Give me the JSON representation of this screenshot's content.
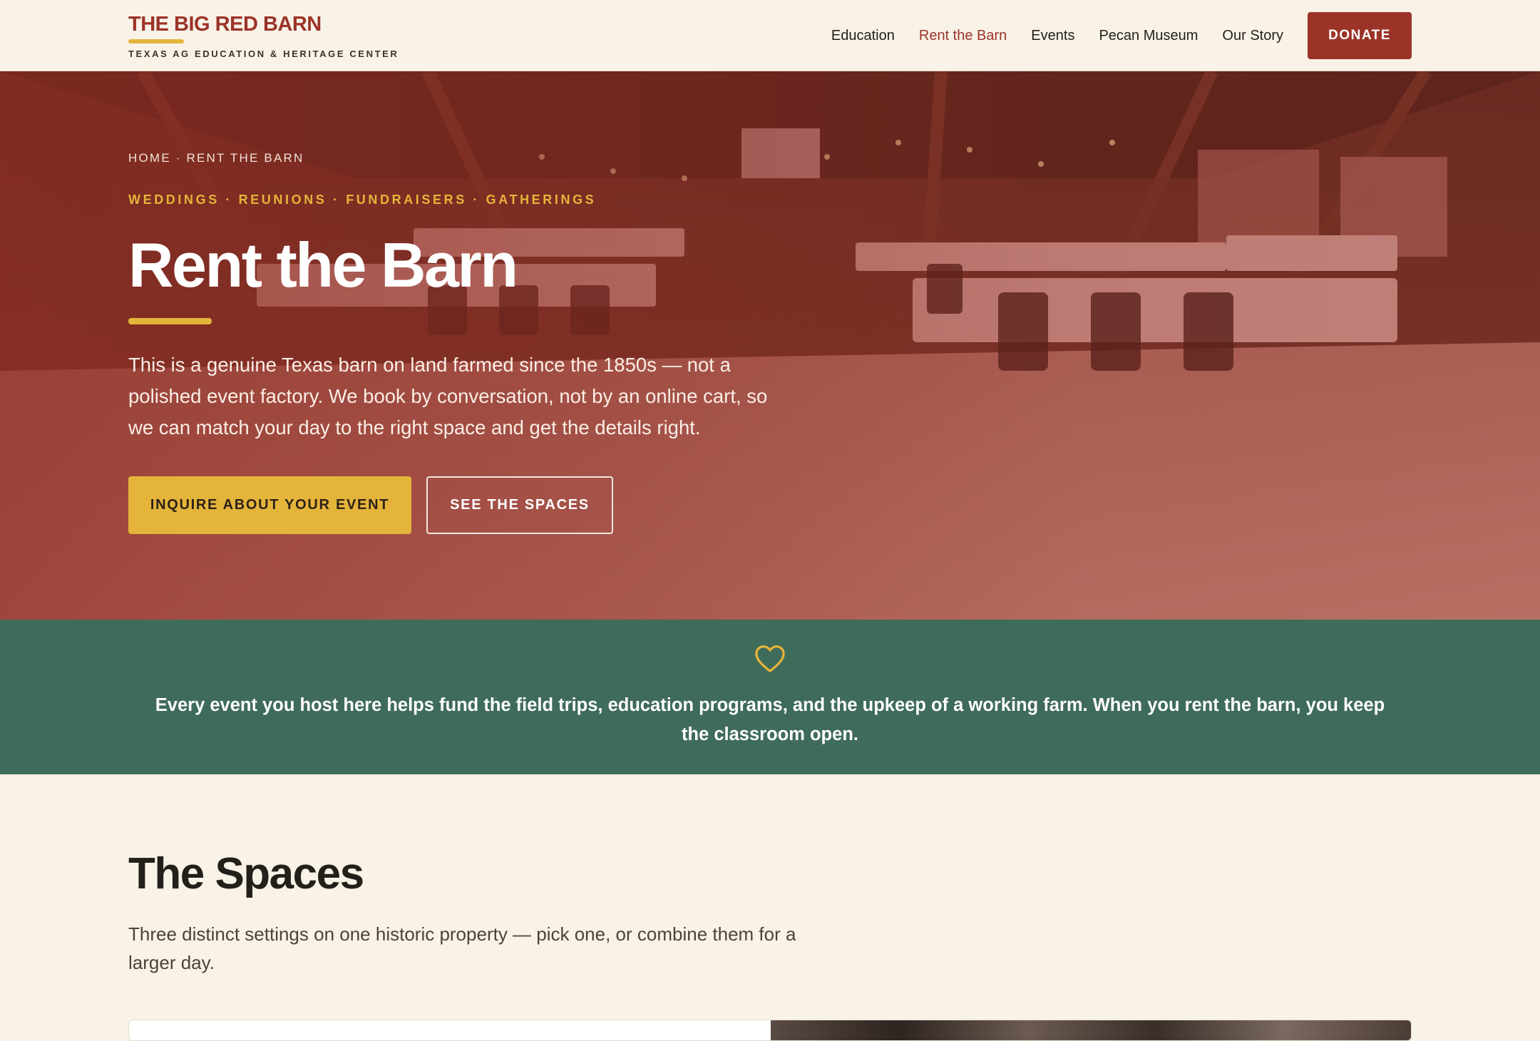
{
  "header": {
    "brand_name": "THE BIG RED BARN",
    "brand_tagline": "TEXAS AG EDUCATION & HERITAGE CENTER",
    "nav": [
      {
        "label": "Education"
      },
      {
        "label": "Rent the Barn",
        "active": true
      },
      {
        "label": "Events"
      },
      {
        "label": "Pecan Museum"
      },
      {
        "label": "Our Story"
      }
    ],
    "donate_label": "DONATE"
  },
  "hero": {
    "breadcrumb": "HOME · RENT THE BARN",
    "eyebrow": "WEDDINGS · REUNIONS · FUNDRAISERS · GATHERINGS",
    "title": "Rent the Barn",
    "description": "This is a genuine Texas barn on land farmed since the 1850s — not a polished event factory. We book by conversation, not by an online cart, so we can match your day to the right space and get the details right.",
    "primary_cta": "INQUIRE ABOUT YOUR EVENT",
    "secondary_cta": "SEE THE SPACES"
  },
  "mission": {
    "icon": "heart-icon",
    "text": "Every event you host here helps fund the field trips, education programs, and the upkeep of a working farm. When you rent the barn, you keep the classroom open."
  },
  "spaces": {
    "title": "The Spaces",
    "description": "Three distinct settings on one historic property — pick one, or combine them for a larger day."
  },
  "colors": {
    "brand_red": "#9c3328",
    "gold": "#e5b43a",
    "green": "#3f6b5b",
    "cream": "#f8f2e7"
  }
}
